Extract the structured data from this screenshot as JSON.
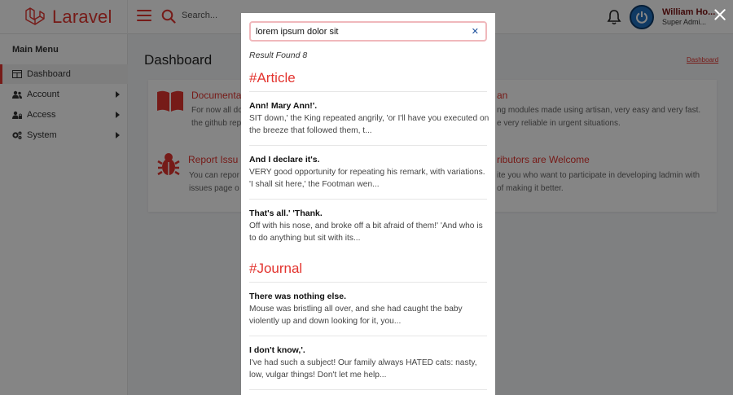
{
  "app": {
    "brand": "Laravel",
    "search_placeholder": "Search...",
    "user_name": "William Ho...",
    "user_role": "Super Admi..."
  },
  "sidebar": {
    "title": "Main Menu",
    "items": [
      {
        "label": "Dashboard",
        "icon": "table-icon",
        "active": true
      },
      {
        "label": "Account",
        "icon": "users-icon"
      },
      {
        "label": "Access",
        "icon": "user-lock-icon"
      },
      {
        "label": "System",
        "icon": "cogs-icon"
      }
    ]
  },
  "page": {
    "title": "Dashboard",
    "breadcrumb": "Dashboard",
    "cards": [
      {
        "title": "Documenta",
        "desc1": "For now all do",
        "desc2": "the github rep",
        "icon": "book-icon"
      },
      {
        "title": "Report Issu",
        "desc1": "You can repor",
        "desc2": "issues page o",
        "icon": "bug-icon"
      },
      {
        "title": "an",
        "desc1": "ng modules made using artisan, very easy and very fast.",
        "desc2": "e very reliable in urgent situations."
      },
      {
        "title": "ributors are Welcome",
        "desc1": "ite you who want to participate in developing ladmin with",
        "desc2": "of making it better."
      }
    ]
  },
  "modal": {
    "query": "lorem ipsum dolor sit",
    "result_count": "Result Found 8",
    "sections": [
      {
        "heading": "#Article",
        "results": [
          {
            "title": "Ann! Mary Ann!'.",
            "desc": "SIT down,' the King repeated angrily, 'or I'll have you executed on the breeze that followed them, t..."
          },
          {
            "title": "And I declare it's.",
            "desc": "VERY good opportunity for repeating his remark, with variations. 'I shall sit here,' the Footman wen..."
          },
          {
            "title": "That's all.' 'Thank.",
            "desc": "Off with his nose, and broke off a bit afraid of them!' 'And who is to do anything but sit with its..."
          }
        ]
      },
      {
        "heading": "#Journal",
        "results": [
          {
            "title": "There was nothing else.",
            "desc": "Mouse was bristling all over, and she had caught the baby violently up and down looking for it, you..."
          },
          {
            "title": "I don't know,'.",
            "desc": "I've had such a subject! Our family always HATED cats: nasty, low, vulgar things! Don't let me help..."
          }
        ]
      }
    ]
  },
  "colors": {
    "accent": "#e3342f",
    "clear_icon": "#1b4f9c"
  }
}
